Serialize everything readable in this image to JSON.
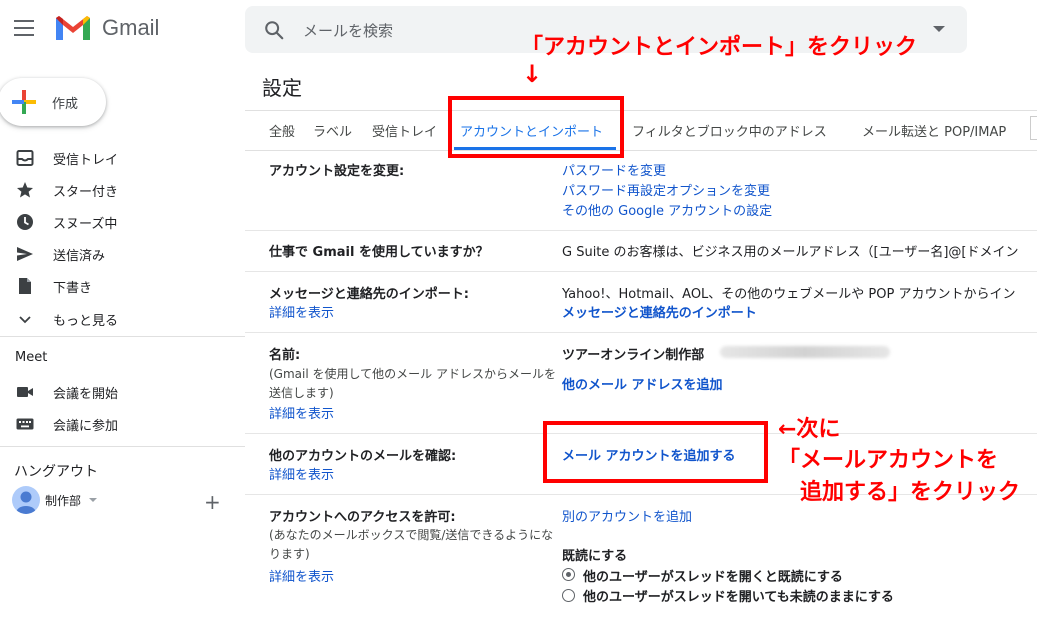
{
  "header": {
    "app_name": "Gmail",
    "search_placeholder": "メールを検索"
  },
  "sidebar": {
    "compose_label": "作成",
    "items": [
      {
        "label": "受信トレイ",
        "icon": "inbox-icon"
      },
      {
        "label": "スター付き",
        "icon": "star-icon"
      },
      {
        "label": "スヌーズ中",
        "icon": "clock-icon"
      },
      {
        "label": "送信済み",
        "icon": "send-icon"
      },
      {
        "label": "下書き",
        "icon": "draft-icon"
      },
      {
        "label": "もっと見る",
        "icon": "chevron-down-icon"
      }
    ],
    "meet": {
      "title": "Meet",
      "items": [
        {
          "label": "会議を開始",
          "icon": "video-icon"
        },
        {
          "label": "会議に参加",
          "icon": "keyboard-icon"
        }
      ]
    },
    "hangouts": {
      "title": "ハングアウト",
      "user_name": "制作部"
    }
  },
  "settings": {
    "title": "設定",
    "tabs": [
      {
        "label": "全般",
        "active": false
      },
      {
        "label": "ラベル",
        "active": false
      },
      {
        "label": "受信トレイ",
        "active": false
      },
      {
        "label": "アカウントとインポート",
        "active": true
      },
      {
        "label": "フィルタとブロック中のアドレス",
        "active": false
      },
      {
        "label": "メール転送と POP/IMAP",
        "active": false
      }
    ],
    "rows": {
      "change_account": {
        "label": "アカウント設定を変更:",
        "links": [
          "パスワードを変更",
          "パスワード再設定オプションを変更",
          "その他の Google アカウントの設定"
        ]
      },
      "work": {
        "label": "仕事で Gmail を使用していますか？",
        "value": "G Suite のお客様は、ビジネス用のメールアドレス（[ユーザー名]@[ドメイン"
      },
      "import": {
        "label": "メッセージと連絡先のインポート:",
        "details": "詳細を表示",
        "value": "Yahoo!、Hotmail、AOL、その他のウェブメールや POP アカウントからイン",
        "link": "メッセージと連絡先のインポート"
      },
      "name": {
        "label": "名前:",
        "desc_line1": "(Gmail を使用して他のメール アドレスからメールを",
        "desc_line2": "送信します)",
        "details": "詳細を表示",
        "value": "ツアーオンライン制作部",
        "link": "他のメール アドレスを追加"
      },
      "check_mail": {
        "label": "他のアカウントのメールを確認:",
        "details": "詳細を表示",
        "link": "メール アカウントを追加する"
      },
      "grant_access": {
        "label": "アカウントへのアクセスを許可:",
        "desc_line1": "(あなたのメールボックスで閲覧/送信できるようにな",
        "desc_line2": "ります)",
        "details": "詳細を表示",
        "link": "別のアカウントを追加",
        "mark_read_title": "既読にする",
        "radio_on": "他のユーザーがスレッドを開くと既読にする",
        "radio_off": "他のユーザーがスレッドを開いても未読のままにする"
      }
    }
  },
  "annotations": {
    "top_instruction": "「アカウントとインポート」をクリック",
    "arrow": "↓",
    "side_line1": "←次に",
    "side_line2": "「メールアカウントを",
    "side_line3": "追加する」をクリック",
    "color": "#ff0000"
  }
}
